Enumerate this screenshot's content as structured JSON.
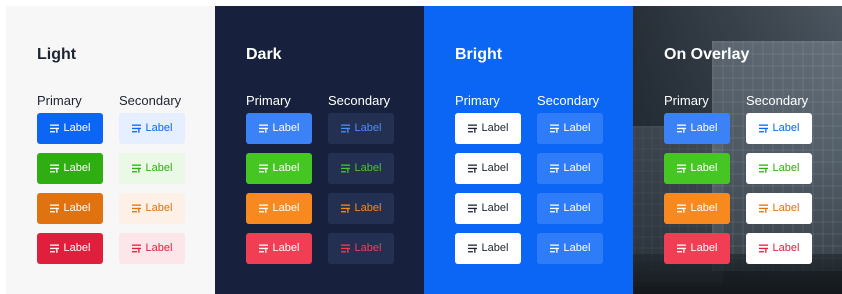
{
  "panels": [
    {
      "name": "light",
      "title": "Light",
      "primary_label": "Primary",
      "secondary_label": "Secondary",
      "primary": [
        {
          "label": "Label",
          "bg": "#0b66f6",
          "fg": "#ffffff"
        },
        {
          "label": "Label",
          "bg": "#2fae12",
          "fg": "#ffffff"
        },
        {
          "label": "Label",
          "bg": "#e07310",
          "fg": "#ffffff"
        },
        {
          "label": "Label",
          "bg": "#e01f3d",
          "fg": "#ffffff"
        }
      ],
      "secondary": [
        {
          "label": "Label",
          "bg": "#e6efff",
          "fg": "#0b66f6"
        },
        {
          "label": "Label",
          "bg": "#eaf8e6",
          "fg": "#2fae12"
        },
        {
          "label": "Label",
          "bg": "#fdf0e6",
          "fg": "#e07310"
        },
        {
          "label": "Label",
          "bg": "#fde6ea",
          "fg": "#e01f3d"
        }
      ]
    },
    {
      "name": "dark",
      "title": "Dark",
      "primary_label": "Primary",
      "secondary_label": "Secondary",
      "primary": [
        {
          "label": "Label",
          "bg": "#3b82f6",
          "fg": "#ffffff"
        },
        {
          "label": "Label",
          "bg": "#45c623",
          "fg": "#ffffff"
        },
        {
          "label": "Label",
          "bg": "#f7891f",
          "fg": "#ffffff"
        },
        {
          "label": "Label",
          "bg": "#f23e55",
          "fg": "#ffffff"
        }
      ],
      "secondary": [
        {
          "label": "Label",
          "bg": "#233052",
          "fg": "#4d8ef7"
        },
        {
          "label": "Label",
          "bg": "#233052",
          "fg": "#48c62a"
        },
        {
          "label": "Label",
          "bg": "#233052",
          "fg": "#f7891f"
        },
        {
          "label": "Label",
          "bg": "#233052",
          "fg": "#f23e55"
        }
      ]
    },
    {
      "name": "bright",
      "title": "Bright",
      "primary_label": "Primary",
      "secondary_label": "Secondary",
      "primary": [
        {
          "label": "Label",
          "bg": "#ffffff",
          "fg": "#1d2433"
        },
        {
          "label": "Label",
          "bg": "#ffffff",
          "fg": "#1d2433"
        },
        {
          "label": "Label",
          "bg": "#ffffff",
          "fg": "#1d2433"
        },
        {
          "label": "Label",
          "bg": "#ffffff",
          "fg": "#1d2433"
        }
      ],
      "secondary": [
        {
          "label": "Label",
          "bg": "#2f7cf8",
          "fg": "#ffffff"
        },
        {
          "label": "Label",
          "bg": "#2f7cf8",
          "fg": "#ffffff"
        },
        {
          "label": "Label",
          "bg": "#2f7cf8",
          "fg": "#ffffff"
        },
        {
          "label": "Label",
          "bg": "#2f7cf8",
          "fg": "#ffffff"
        }
      ]
    },
    {
      "name": "overlay",
      "title": "On Overlay",
      "primary_label": "Primary",
      "secondary_label": "Secondary",
      "primary": [
        {
          "label": "Label",
          "bg": "#3b82f6",
          "fg": "#ffffff"
        },
        {
          "label": "Label",
          "bg": "#45c623",
          "fg": "#ffffff"
        },
        {
          "label": "Label",
          "bg": "#f7891f",
          "fg": "#ffffff"
        },
        {
          "label": "Label",
          "bg": "#f23e55",
          "fg": "#ffffff"
        }
      ],
      "secondary": [
        {
          "label": "Label",
          "bg": "#ffffff",
          "fg": "#0b66f6"
        },
        {
          "label": "Label",
          "bg": "#ffffff",
          "fg": "#2fae12"
        },
        {
          "label": "Label",
          "bg": "#ffffff",
          "fg": "#e07310"
        },
        {
          "label": "Label",
          "bg": "#ffffff",
          "fg": "#e01f3d"
        }
      ]
    }
  ],
  "icon": "list-filter-icon"
}
